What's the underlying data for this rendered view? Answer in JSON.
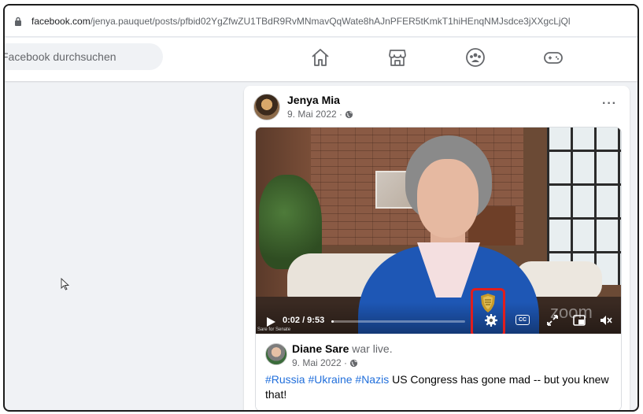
{
  "browser": {
    "url_host": "facebook.com",
    "url_path": "/jenya.pauquet/posts/pfbid02YgZfwZU1TBdR9RvMNmavQqWate8hAJnPFER5tKmkT1hiHEnqNMJsdce3jXXgcLjQl"
  },
  "fb_header": {
    "search_placeholder": "Facebook durchsuchen",
    "nav_icons": [
      "home-icon",
      "marketplace-icon",
      "groups-icon",
      "gaming-icon"
    ]
  },
  "post": {
    "author": "Jenya Mia",
    "date": "9. Mai 2022 ·",
    "more_label": "···",
    "video": {
      "timecode": "0:02 / 9:53",
      "progress_fraction": 0.02,
      "cc_label": "CC",
      "watermark": "Sare for Senate",
      "brand_logo": "zoom"
    },
    "shared": {
      "author": "Diane Sare",
      "action": "war live.",
      "date": "9. Mai 2022 ·",
      "hashtags": [
        "#Russia",
        "#Ukraine",
        "#Nazis"
      ],
      "text": "US Congress has gone mad -- but you knew that!"
    }
  },
  "colors": {
    "facebook_blue": "#216fdb",
    "highlight_red": "#e01e1e",
    "page_bg": "#f0f2f5"
  }
}
